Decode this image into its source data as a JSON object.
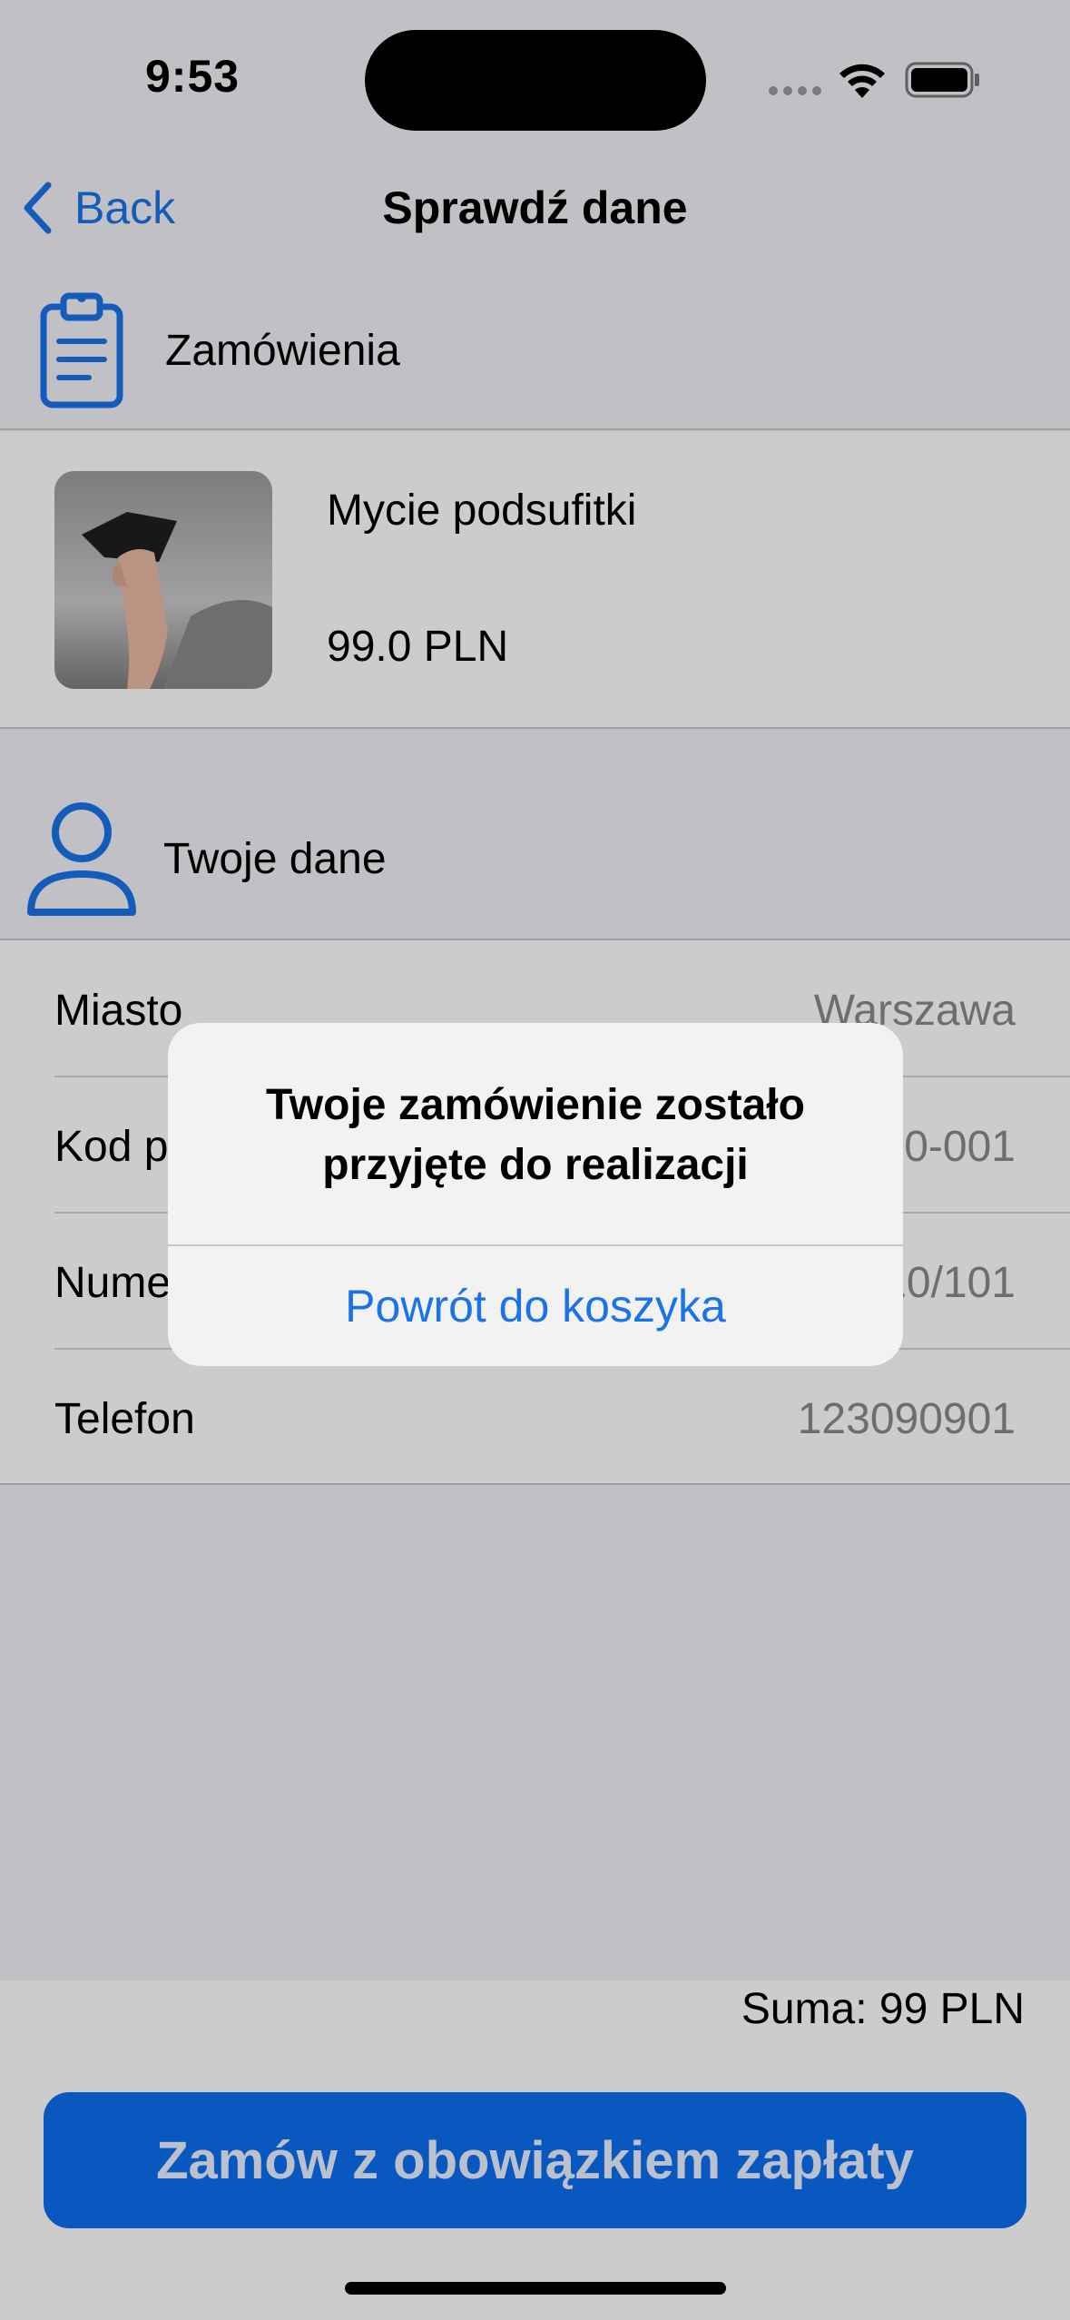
{
  "status_bar": {
    "time": "9:53"
  },
  "nav": {
    "back_label": "Back",
    "title": "Sprawdź dane"
  },
  "orders_section": {
    "label": "Zamówienia"
  },
  "order_item": {
    "name": "Mycie podsufitki",
    "price": "99.0 PLN"
  },
  "user_section": {
    "label": "Twoje dane"
  },
  "user_data": [
    {
      "key": "Miasto",
      "value": "Warszawa"
    },
    {
      "key": "Kod pocztowy",
      "value": "00-001"
    },
    {
      "key": "Numer domu",
      "value": "10/101"
    },
    {
      "key": "Telefon",
      "value": "123090901"
    }
  ],
  "footer": {
    "sum": "Suma: 99 PLN",
    "order_button": "Zamów z obowiązkiem zapłaty"
  },
  "alert": {
    "title": "Twoje zamówienie zostało przyjęte do realizacji",
    "button": "Powrót do koszyka"
  },
  "colors": {
    "accent": "#1a73e8",
    "primary_button": "#0a6ff0",
    "background": "#f2f2f7"
  }
}
